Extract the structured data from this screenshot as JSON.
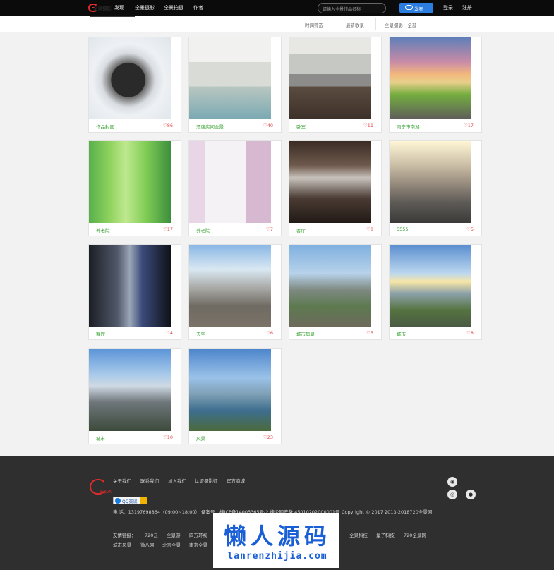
{
  "topbar": {
    "nav": [
      "发现",
      "全景摄影",
      "全景拍摄",
      "作者"
    ],
    "search_placeholder": "请输入全景作品名称",
    "publish_label": "发布",
    "login": "登录",
    "register": "注册"
  },
  "subheader": {
    "active_tab": "全景摄影",
    "filter_time": "时间筛选",
    "filter_type": "最新收录",
    "filter_category": "全景摄影：全部"
  },
  "cards": [
    {
      "title": "作品封面",
      "likes": "86"
    },
    {
      "title": "酒店房间全景",
      "likes": "40"
    },
    {
      "title": "卧室",
      "likes": "11"
    },
    {
      "title": "南宁市南湖",
      "likes": "17"
    },
    {
      "title": "养老院",
      "likes": "17"
    },
    {
      "title": "养老院",
      "likes": "7"
    },
    {
      "title": "客厅",
      "likes": "8"
    },
    {
      "title": "5555",
      "likes": "5"
    },
    {
      "title": "客厅",
      "likes": "4"
    },
    {
      "title": "天空",
      "likes": "6"
    },
    {
      "title": "城市风景",
      "likes": "5"
    },
    {
      "title": "城市",
      "likes": "8"
    },
    {
      "title": "城市",
      "likes": "10"
    },
    {
      "title": "风景",
      "likes": "23"
    }
  ],
  "footer": {
    "links": [
      "关于我们",
      "联系我们",
      "加入我们",
      "认证摄影师",
      "官方商城"
    ],
    "logo_text": "全景VR",
    "qq_label": "QQ交谈",
    "contact_line": "电 话：13197698864（09:00~18:00）   备案号：桂ICP备14005365号-2   桂公网安备 45010202000001号",
    "copyright": "Copyright © 2017 2013-2018720全景网",
    "friend_label": "友情链接：",
    "friend_row1": [
      "720云",
      "全景游",
      "四方环视",
      "全景科技",
      "量子科技",
      "720全景网"
    ],
    "friend_row2": [
      "城市风景",
      "微八网",
      "北京全景",
      "南京全景"
    ],
    "icons": [
      "wechat-icon",
      "weibo-icon",
      "qq-icon"
    ]
  },
  "watermark": {
    "cn": "懒人源码",
    "en": "lanrenzhijia.com"
  },
  "colors": {
    "accent": "#2b7de0",
    "title_green": "#33a02c",
    "like_red": "#e04848",
    "brand_red": "#e02b2b"
  }
}
